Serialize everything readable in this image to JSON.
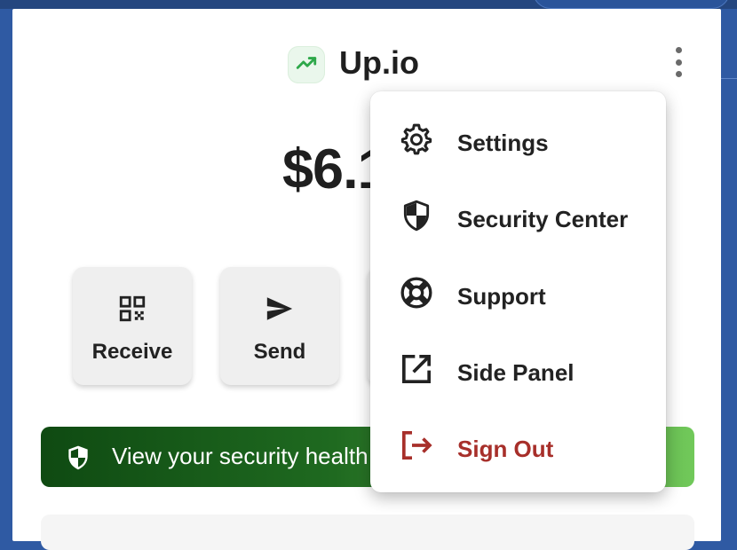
{
  "app": {
    "title": "Up.io",
    "logo_icon": "trending-up-icon"
  },
  "balance": {
    "amount": "$6.1"
  },
  "actions": [
    {
      "label": "Receive",
      "icon": "qr-code-icon"
    },
    {
      "label": "Send",
      "icon": "send-icon"
    }
  ],
  "security_banner": {
    "text": "View your security health",
    "icon": "shield-icon"
  },
  "menu": {
    "items": [
      {
        "label": "Settings",
        "icon": "gear-icon"
      },
      {
        "label": "Security Center",
        "icon": "shield-icon"
      },
      {
        "label": "Support",
        "icon": "lifebuoy-icon"
      },
      {
        "label": "Side Panel",
        "icon": "open-in-new-icon"
      },
      {
        "label": "Sign Out",
        "icon": "sign-out-icon"
      }
    ]
  },
  "colors": {
    "accent_green": "#2ea84a",
    "danger": "#a72f2a",
    "banner_start": "#0f4a12",
    "banner_end": "#71c95a"
  }
}
